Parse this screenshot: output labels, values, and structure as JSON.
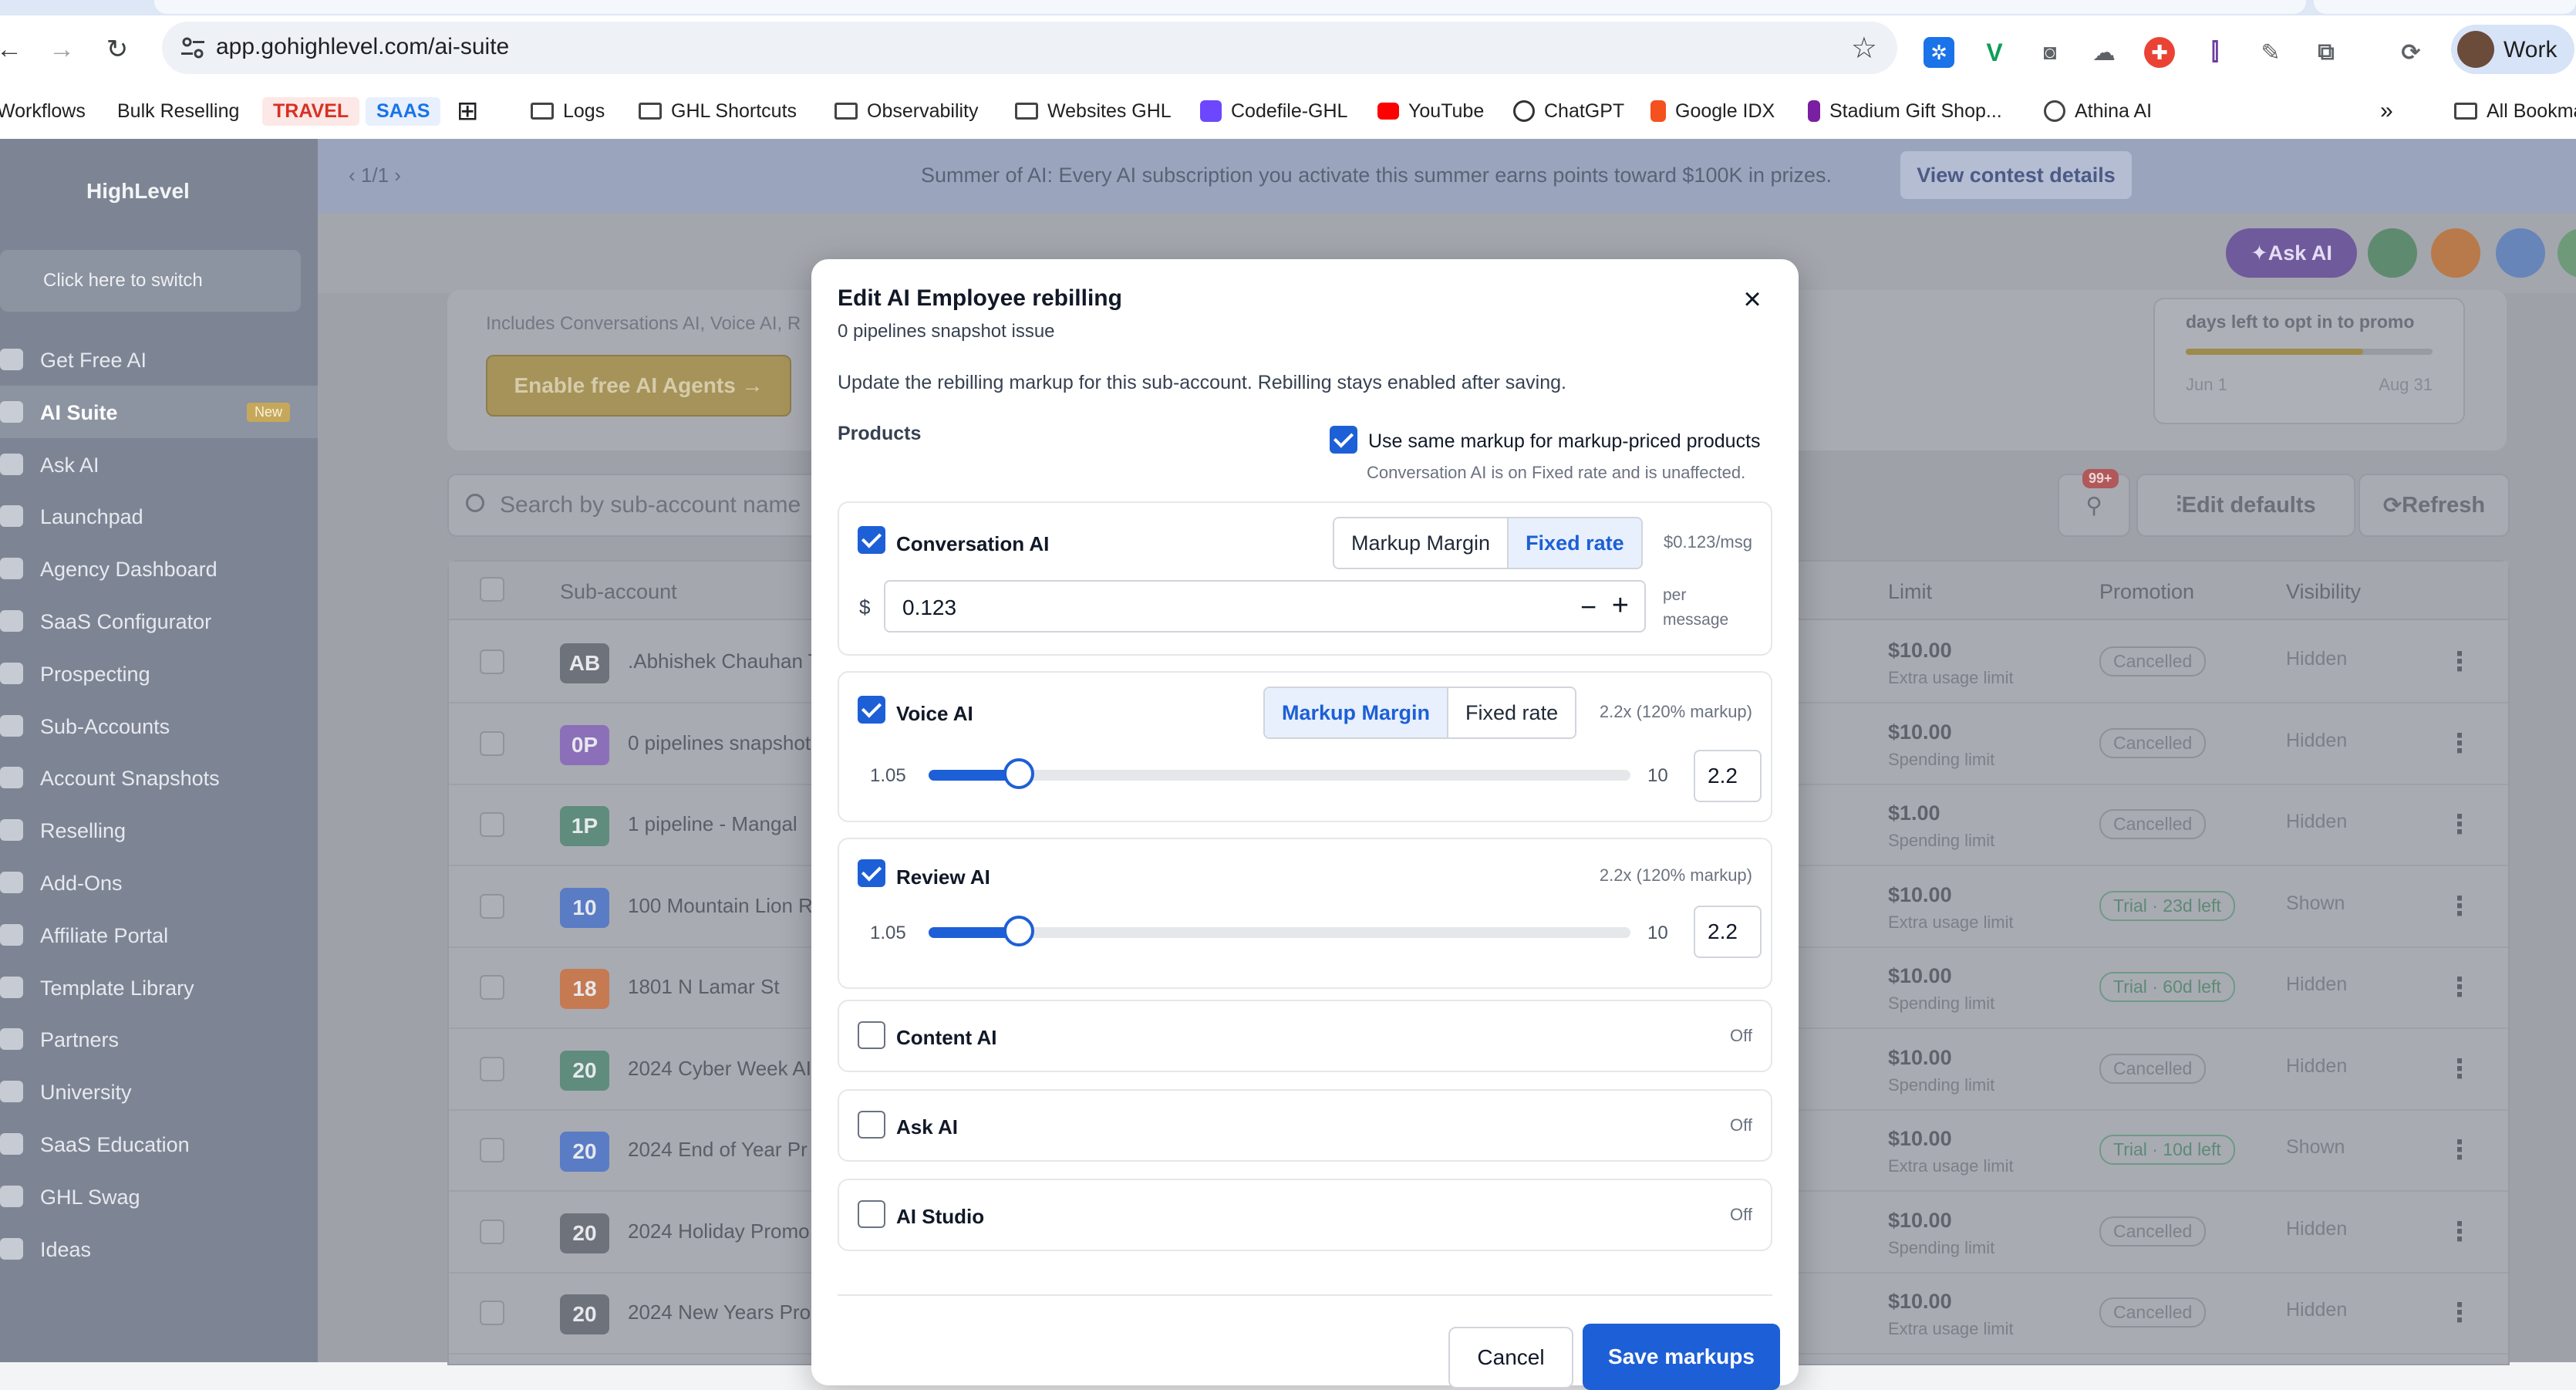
{
  "browser": {
    "url": "app.gohighlevel.com/ai-suite",
    "profile_name": "Work",
    "bookmarks": [
      "Workflows",
      "Bulk Reselling",
      "TRAVEL",
      "SAAS",
      "Logs",
      "GHL Shortcuts",
      "Observability",
      "Websites GHL",
      "Codefile-GHL",
      "YouTube",
      "ChatGPT",
      "Google IDX",
      "Stadium Gift Shop...",
      "Athina AI",
      "All Bookmarks"
    ],
    "overflow": "»"
  },
  "sidebar": {
    "logo": "HighLevel",
    "switcher": "Click here to switch",
    "new_badge": "New",
    "items": [
      "Get Free AI",
      "AI Suite",
      "Ask AI",
      "Launchpad",
      "Agency Dashboard",
      "SaaS Configurator",
      "Prospecting",
      "Sub-Accounts",
      "Account Snapshots",
      "Reselling",
      "Add-Ons",
      "Affiliate Portal",
      "Template Library",
      "Partners",
      "University",
      "SaaS Education",
      "GHL Swag",
      "Ideas"
    ]
  },
  "banner": {
    "pagination": "1/1",
    "message": "Summer of AI: Every AI subscription you activate this summer earns points toward $100K in prizes.",
    "button": "View contest details"
  },
  "header": {
    "ask_ai": "Ask AI"
  },
  "promo_card": {
    "includes": "Includes Conversations AI, Voice AI, R",
    "enable_button": "Enable free AI Agents →",
    "days_label": "days left to opt in to promo",
    "date_start": "Jun 1",
    "date_end": "Aug 31",
    "progress": 0.72
  },
  "toolbar": {
    "search_placeholder": "Search by sub-account name",
    "badge": "99+",
    "edit_defaults": "Edit defaults",
    "refresh": "Refresh"
  },
  "table": {
    "columns": {
      "subaccount": "Sub-account",
      "limit": "Limit",
      "promotion": "Promotion",
      "visibility": "Visibility"
    },
    "rows": [
      {
        "initials": "AB",
        "color": "#6e727a",
        "name": ".Abhishek Chauhan T",
        "limit": "$10.00",
        "limit_sub": "Extra usage limit",
        "promotion": "Cancelled",
        "visibility": "Hidden"
      },
      {
        "initials": "0P",
        "color": "#8b6fb8",
        "name": "0 pipelines snapshot",
        "limit": "$10.00",
        "limit_sub": "Spending limit",
        "promotion": "Cancelled",
        "visibility": "Hidden"
      },
      {
        "initials": "1P",
        "color": "#5f8c7c",
        "name": "1 pipeline - Mangal",
        "limit": "$1.00",
        "limit_sub": "Spending limit",
        "promotion": "Cancelled",
        "visibility": "Hidden"
      },
      {
        "initials": "10",
        "color": "#5a7cc4",
        "name": "100 Mountain Lion R",
        "limit": "$10.00",
        "limit_sub": "Extra usage limit",
        "promotion": "Trial · 23d left",
        "visibility": "Shown"
      },
      {
        "initials": "18",
        "color": "#c67a52",
        "name": "1801 N Lamar St",
        "limit": "$10.00",
        "limit_sub": "Spending limit",
        "promotion": "Trial · 60d left",
        "visibility": "Hidden"
      },
      {
        "initials": "20",
        "color": "#5f8c7c",
        "name": "2024 Cyber Week AI",
        "limit": "$10.00",
        "limit_sub": "Spending limit",
        "promotion": "Cancelled",
        "visibility": "Hidden"
      },
      {
        "initials": "20",
        "color": "#5a7cc4",
        "name": "2024 End of Year Pr",
        "limit": "$10.00",
        "limit_sub": "Extra usage limit",
        "promotion": "Trial · 10d left",
        "visibility": "Shown"
      },
      {
        "initials": "20",
        "color": "#6e727a",
        "name": "2024 Holiday Promo",
        "limit": "$10.00",
        "limit_sub": "Spending limit",
        "promotion": "Cancelled",
        "visibility": "Hidden"
      },
      {
        "initials": "20",
        "color": "#6e727a",
        "name": "2024 New Years Pro",
        "limit": "$10.00",
        "limit_sub": "Extra usage limit",
        "promotion": "Cancelled",
        "visibility": "Hidden"
      }
    ]
  },
  "modal": {
    "title": "Edit AI Employee rebilling",
    "subtitle": "0 pipelines snapshot issue",
    "description": "Update the rebilling markup for this sub-account. Rebilling stays enabled after saving.",
    "products_label": "Products",
    "same_markup_label": "Use same markup for markup-priced products",
    "same_markup_note": "Conversation AI is on Fixed rate and is unaffected.",
    "segment_margin": "Markup Margin",
    "segment_fixed": "Fixed rate",
    "conversation_ai": {
      "name": "Conversation AI",
      "meta": "$0.123/msg",
      "currency": "$",
      "value": "0.123",
      "unit": "per message"
    },
    "voice_ai": {
      "name": "Voice AI",
      "meta": "2.2x (120% markup)",
      "min": "1.05",
      "max": "10",
      "value": "2.2"
    },
    "review_ai": {
      "name": "Review AI",
      "meta": "2.2x (120% markup)",
      "min": "1.05",
      "max": "10",
      "value": "2.2"
    },
    "content_ai": {
      "name": "Content AI",
      "meta": "Off"
    },
    "ask_ai": {
      "name": "Ask AI",
      "meta": "Off"
    },
    "ai_studio": {
      "name": "AI Studio",
      "meta": "Off"
    },
    "cancel": "Cancel",
    "save": "Save markups"
  }
}
